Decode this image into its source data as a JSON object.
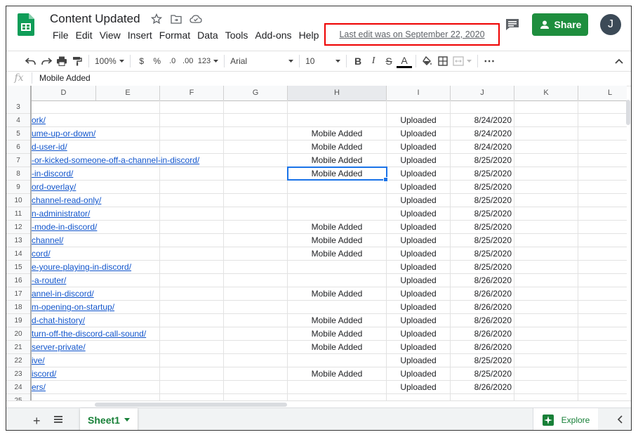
{
  "doc": {
    "title": "Content Updated"
  },
  "menu": [
    "File",
    "Edit",
    "View",
    "Insert",
    "Format",
    "Data",
    "Tools",
    "Add-ons",
    "Help"
  ],
  "last_edit": "Last edit was on September 22, 2020",
  "share_label": "Share",
  "avatar_initial": "J",
  "toolbar": {
    "zoom": "100%",
    "currency": "$",
    "percent": "%",
    "dec_less": ".0",
    "dec_more": ".00",
    "format_more": "123",
    "font": "Arial",
    "size": "10",
    "bold": "B",
    "italic": "I",
    "strike": "S",
    "text_color": "A",
    "more": "⋯"
  },
  "formula_bar": {
    "fx": "fx",
    "value": "Mobile Added"
  },
  "columns": [
    "D",
    "E",
    "F",
    "G",
    "H",
    "I",
    "J",
    "K",
    "L"
  ],
  "rows": [
    {
      "n": "3",
      "d": "",
      "h": "",
      "i": "",
      "j": ""
    },
    {
      "n": "4",
      "d": "ork/",
      "h": "",
      "i": "Uploaded",
      "j": "8/24/2020"
    },
    {
      "n": "5",
      "d": "ume-up-or-down/",
      "h": "Mobile Added",
      "i": "Uploaded",
      "j": "8/24/2020"
    },
    {
      "n": "6",
      "d": "d-user-id/",
      "h": "Mobile Added",
      "i": "Uploaded",
      "j": "8/24/2020"
    },
    {
      "n": "7",
      "d": "-or-kicked-someone-off-a-channel-in-discord/",
      "h": "Mobile Added",
      "i": "Uploaded",
      "j": "8/25/2020"
    },
    {
      "n": "8",
      "d": "-in-discord/",
      "h": "Mobile Added",
      "i": "Uploaded",
      "j": "8/25/2020"
    },
    {
      "n": "9",
      "d": "ord-overlay/",
      "h": "",
      "i": "Uploaded",
      "j": "8/25/2020"
    },
    {
      "n": "10",
      "d": "channel-read-only/",
      "h": "",
      "i": "Uploaded",
      "j": "8/25/2020"
    },
    {
      "n": "11",
      "d": "n-administrator/",
      "h": "",
      "i": "Uploaded",
      "j": "8/25/2020"
    },
    {
      "n": "12",
      "d": "-mode-in-discord/",
      "h": "Mobile Added",
      "i": "Uploaded",
      "j": "8/25/2020"
    },
    {
      "n": "13",
      "d": "channel/",
      "h": "Mobile Added",
      "i": "Uploaded",
      "j": "8/25/2020"
    },
    {
      "n": "14",
      "d": "cord/",
      "h": "Mobile Added",
      "i": "Uploaded",
      "j": "8/25/2020"
    },
    {
      "n": "15",
      "d": "e-youre-playing-in-discord/",
      "h": "",
      "i": "Uploaded",
      "j": "8/25/2020"
    },
    {
      "n": "16",
      "d": "-a-router/",
      "h": "",
      "i": "Uploaded",
      "j": "8/26/2020"
    },
    {
      "n": "17",
      "d": "annel-in-discord/",
      "h": "Mobile Added",
      "i": "Uploaded",
      "j": "8/26/2020"
    },
    {
      "n": "18",
      "d": "m-opening-on-startup/",
      "h": "",
      "i": "Uploaded",
      "j": "8/26/2020"
    },
    {
      "n": "19",
      "d": "d-chat-history/",
      "h": "Mobile Added",
      "i": "Uploaded",
      "j": "8/26/2020"
    },
    {
      "n": "20",
      "d": "turn-off-the-discord-call-sound/",
      "h": "Mobile Added",
      "i": "Uploaded",
      "j": "8/26/2020"
    },
    {
      "n": "21",
      "d": "server-private/",
      "h": "Mobile Added",
      "i": "Uploaded",
      "j": "8/26/2020"
    },
    {
      "n": "22",
      "d": "ive/",
      "h": "",
      "i": "Uploaded",
      "j": "8/25/2020"
    },
    {
      "n": "23",
      "d": "iscord/",
      "h": "Mobile Added",
      "i": "Uploaded",
      "j": "8/25/2020"
    },
    {
      "n": "24",
      "d": "ers/",
      "h": "",
      "i": "Uploaded",
      "j": "8/26/2020"
    },
    {
      "n": "25",
      "d": "",
      "h": "",
      "i": "",
      "j": ""
    }
  ],
  "sheet_tab": "Sheet1",
  "explore_label": "Explore",
  "colors": {
    "share_green": "#1e8e3e",
    "link_blue": "#1155cc",
    "highlight_red": "#e00000",
    "selection_blue": "#1a73e8"
  }
}
